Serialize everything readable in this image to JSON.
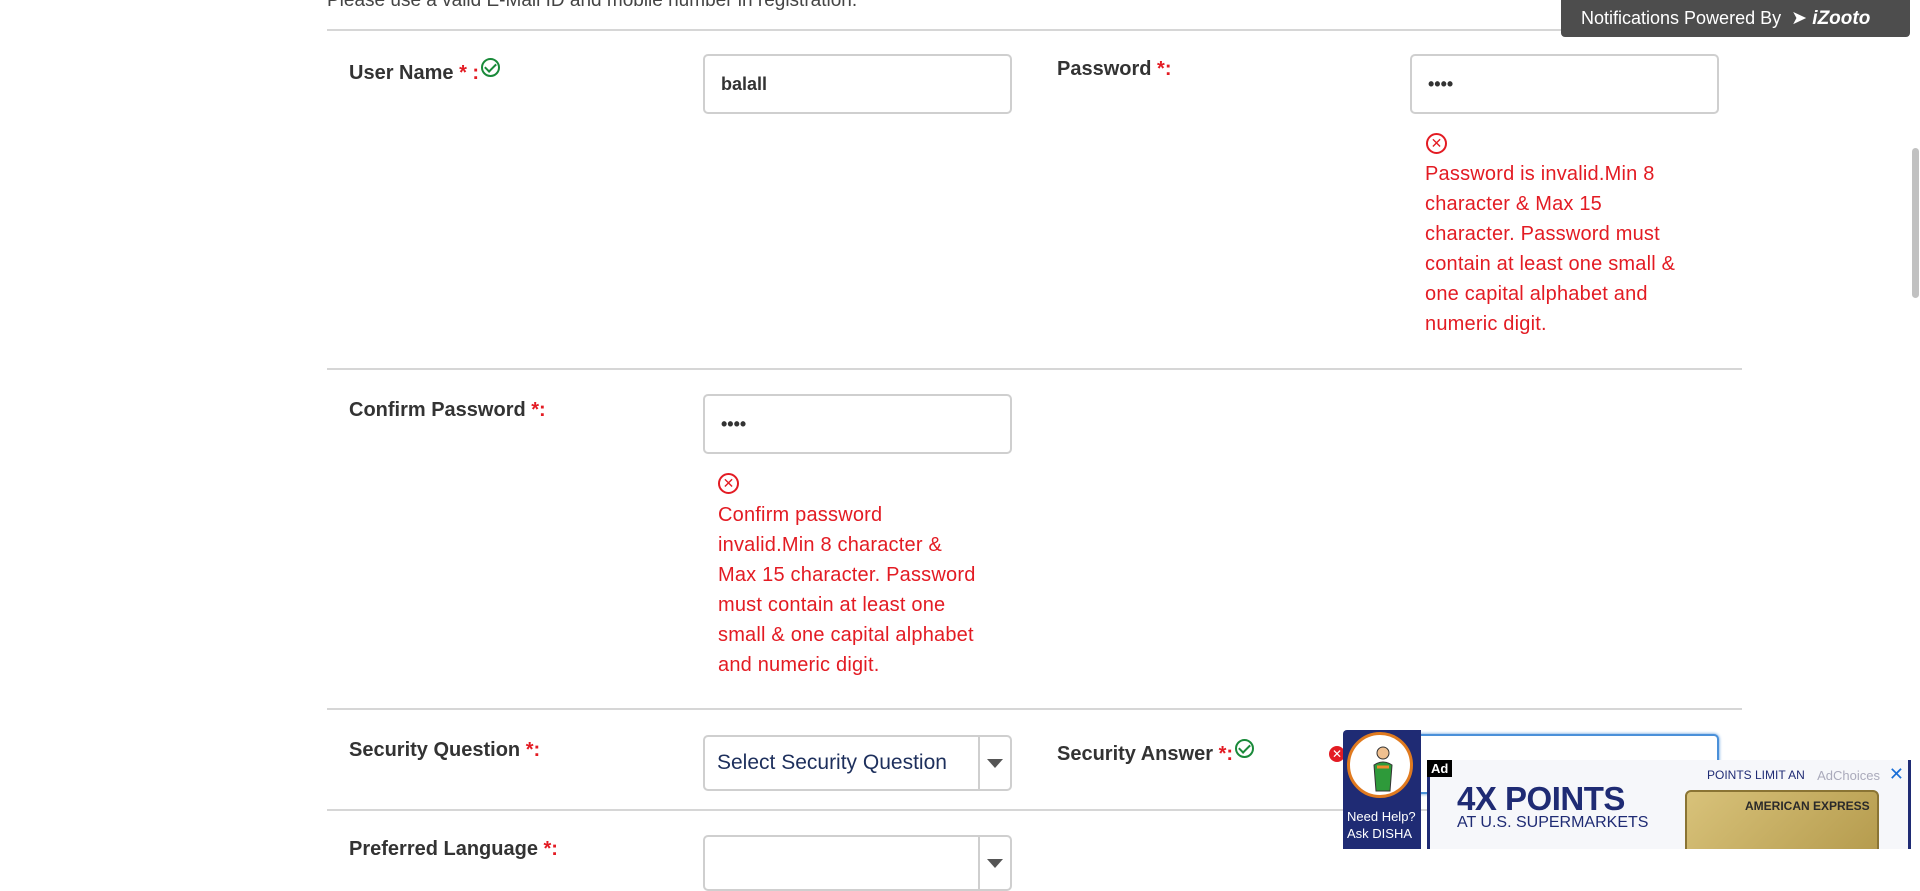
{
  "form": {
    "notice": "Please use a valid E-Mail ID and mobile number in registration.",
    "username": {
      "label": "User Name",
      "req_mark": "* :",
      "value": "balall"
    },
    "password": {
      "label": "Password",
      "req_mark": "*:",
      "value": "••••",
      "error_icon": "x-circle-icon",
      "error_lines": [
        "Password is invalid.Min 8",
        "character & Max 15",
        "character. Password must",
        "contain at least one small &",
        "one capital alphabet and",
        "numeric digit."
      ]
    },
    "confirm_password": {
      "label": "Confirm Password",
      "req_mark": "*:",
      "value": "••••",
      "error_icon": "x-circle-icon",
      "error_lines": [
        "Confirm password",
        "invalid.Min 8 character &",
        "Max 15 character. Password",
        "must contain at least one",
        "small & one capital alphabet",
        "and numeric digit."
      ]
    },
    "security_question": {
      "label": "Security Question",
      "req_mark": "*:",
      "selected": "Select Security Question"
    },
    "security_answer": {
      "label": "Security Answer",
      "req_mark": "*:"
    },
    "preferred_language": {
      "label": "Preferred Language",
      "req_mark": "*:"
    }
  },
  "notification_bar": {
    "text": "Notifications Powered By",
    "brand": "iZooto"
  },
  "disha": {
    "line1": "Need Help?",
    "line2": "Ask DISHA"
  },
  "ad": {
    "tag": "Ad",
    "headline": "4X POINTS",
    "subline": "AT U.S. SUPERMARKETS",
    "top_text": "POINTS LIMIT AN",
    "choices": "AdChoices",
    "card_text": "AMERICAN EXPRESS",
    "close": "✕"
  },
  "colors": {
    "error": "#e31b23",
    "success": "#1a8a3a",
    "ad_navy": "#1f2b74"
  }
}
